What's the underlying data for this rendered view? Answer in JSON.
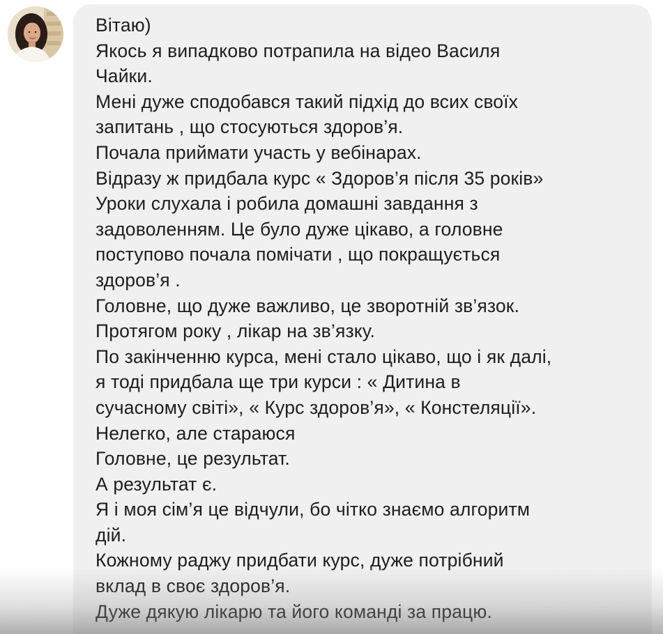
{
  "sender": {
    "avatar_icon": "user-avatar-photo"
  },
  "message": {
    "lines": [
      "Вітаю)",
      "Якось я випадково потрапила на відео Василя",
      "Чайки.",
      "Мені дуже сподобався такий підхід до всих своїх",
      "запитань , що стосуються здоров’я.",
      "Почала приймати участь у  вебінарах.",
      "Відразу ж придбала курс « Здоров’я після 35 років»",
      "Уроки слухала і робила домашні завдання з",
      "задоволенням. Це було дуже цікаво, а головне",
      "поступово почала помічати , що покращується",
      "здоров’я .",
      "Головне, що дуже важливо, це зворотній зв’язок.",
      "Протягом року , лікар на зв’язку.",
      "По закінченню курса, мені стало цікаво, що і як далі,",
      "я тоді придбала ще три курси : « Дитина в",
      "сучасному світі», « Курс здоров’я», « Констеляції».",
      "Нелегко, але стараюся",
      "Головне, це результат.",
      "А результат є.",
      "Я і моя сім’я це відчули, бо чітко знаємо алгоритм",
      "дій.",
      "Кожному раджу придбати курс, дуже потрібний",
      "вклад в своє здоров’я.",
      "Дуже дякую лікарю та його команді за працю."
    ]
  },
  "colors": {
    "bubble_background": "#f0f0f0",
    "text": "#1d1d1f",
    "page_background": "#ffffff"
  }
}
